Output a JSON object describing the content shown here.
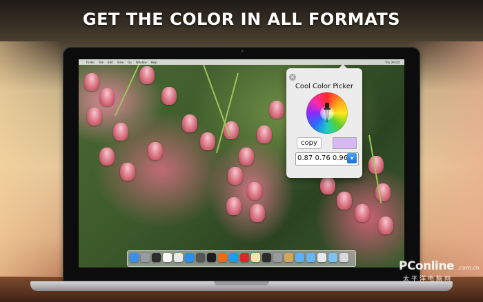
{
  "headline": "GET THE COLOR IN ALL FORMATS",
  "menubar": {
    "apple": "",
    "items": [
      "Finder",
      "File",
      "Edit",
      "View",
      "Go",
      "Window",
      "Help"
    ],
    "clock": "Thu 29 Oct"
  },
  "popover": {
    "title": "Cool Color Picker",
    "close_icon": "close-icon",
    "copy_label": "copy",
    "swatch_color": "#d8b8f4",
    "format_value": "0.87 0.76 0.96",
    "dropdown_icon": "chevron-down-icon"
  },
  "dock": {
    "icons": [
      {
        "name": "finder-icon",
        "color": "#3d8ee8"
      },
      {
        "name": "launchpad-icon",
        "color": "#9a9aa2"
      },
      {
        "name": "dashboard-icon",
        "color": "#2c2c2c"
      },
      {
        "name": "itunes-icon",
        "color": "#f7f7f7"
      },
      {
        "name": "clock-icon",
        "color": "#e9e9e9"
      },
      {
        "name": "safari-icon",
        "color": "#2a8fe8"
      },
      {
        "name": "app-icon",
        "color": "#555555"
      },
      {
        "name": "terminal-icon",
        "color": "#1c1c1c"
      },
      {
        "name": "firefox-icon",
        "color": "#e86a1a"
      },
      {
        "name": "skype-icon",
        "color": "#1ba0e8"
      },
      {
        "name": "opera-icon",
        "color": "#d62a2a"
      },
      {
        "name": "notes-icon",
        "color": "#f2e6a8"
      },
      {
        "name": "preview-icon",
        "color": "#2b2b2b"
      },
      {
        "name": "automator-icon",
        "color": "#9a9aa0"
      },
      {
        "name": "photos-icon",
        "color": "#d3a45c"
      },
      {
        "name": "folder-icon",
        "color": "#5fb1ee"
      },
      {
        "name": "folder-icon",
        "color": "#67b6f0"
      },
      {
        "name": "mail-icon",
        "color": "#e8e8e8"
      },
      {
        "name": "downloads-icon",
        "color": "#7cc2f4"
      },
      {
        "name": "trash-icon",
        "color": "#d9d9dc"
      }
    ]
  },
  "watermark": {
    "brand": "PConline",
    "suffix": ".com.cn",
    "chinese": "太平洋电脑网"
  }
}
